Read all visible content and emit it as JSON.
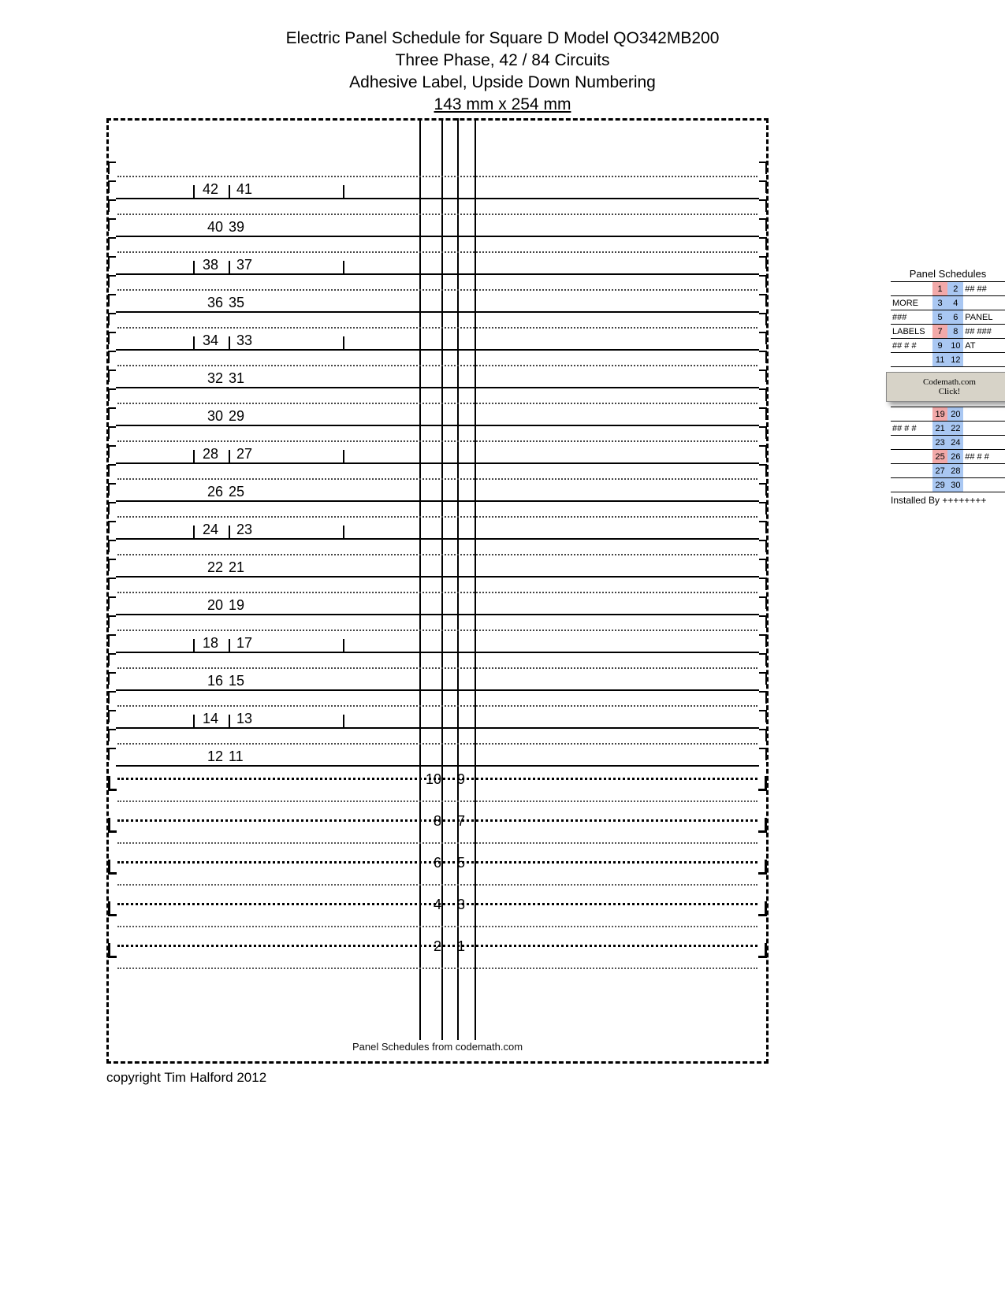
{
  "header": {
    "line1": "Electric Panel Schedule for Square D Model QO342MB200",
    "line2": "Three Phase, 42 / 84 Circuits",
    "line3": "Adhesive Label, Upside Down Numbering",
    "dimensions": "143 mm x 254 mm"
  },
  "rows_upper": [
    {
      "style": "dotted",
      "a": "",
      "b": ""
    },
    {
      "style": "solid",
      "a": "42",
      "b": "41",
      "ticks": true
    },
    {
      "style": "dotted",
      "a": "",
      "b": ""
    },
    {
      "style": "solid",
      "a": "40",
      "b": "39"
    },
    {
      "style": "dotted",
      "a": "",
      "b": ""
    },
    {
      "style": "solid",
      "a": "38",
      "b": "37",
      "ticks": true
    },
    {
      "style": "dotted",
      "a": "",
      "b": ""
    },
    {
      "style": "solid",
      "a": "36",
      "b": "35"
    },
    {
      "style": "dotted",
      "a": "",
      "b": ""
    },
    {
      "style": "solid",
      "a": "34",
      "b": "33",
      "ticks": true
    },
    {
      "style": "dotted",
      "a": "",
      "b": ""
    },
    {
      "style": "solid",
      "a": "32",
      "b": "31"
    },
    {
      "style": "dotted",
      "a": "",
      "b": ""
    },
    {
      "style": "solid",
      "a": "30",
      "b": "29"
    },
    {
      "style": "dotted",
      "a": "",
      "b": ""
    },
    {
      "style": "solid",
      "a": "28",
      "b": "27",
      "ticks": true
    },
    {
      "style": "dotted",
      "a": "",
      "b": ""
    },
    {
      "style": "solid",
      "a": "26",
      "b": "25"
    },
    {
      "style": "dotted",
      "a": "",
      "b": ""
    },
    {
      "style": "solid",
      "a": "24",
      "b": "23",
      "ticks": true
    },
    {
      "style": "dotted",
      "a": "",
      "b": ""
    },
    {
      "style": "solid",
      "a": "22",
      "b": "21"
    },
    {
      "style": "dotted",
      "a": "",
      "b": ""
    },
    {
      "style": "solid",
      "a": "20",
      "b": "19"
    },
    {
      "style": "dotted",
      "a": "",
      "b": ""
    },
    {
      "style": "solid",
      "a": "18",
      "b": "17",
      "ticks": true
    },
    {
      "style": "dotted",
      "a": "",
      "b": ""
    },
    {
      "style": "solid",
      "a": "16",
      "b": "15"
    },
    {
      "style": "dotted",
      "a": "",
      "b": ""
    },
    {
      "style": "solid",
      "a": "14",
      "b": "13",
      "ticks": true
    },
    {
      "style": "dotted",
      "a": "",
      "b": ""
    },
    {
      "style": "solid",
      "a": "12",
      "b": "11"
    }
  ],
  "rows_center": [
    {
      "a": "10",
      "b": "9"
    },
    {
      "a": "8",
      "b": "7"
    },
    {
      "a": "6",
      "b": "5"
    },
    {
      "a": "4",
      "b": "3"
    },
    {
      "a": "2",
      "b": "1"
    }
  ],
  "footer_inside": "Panel Schedules from codemath.com",
  "copyright": "copyright Tim Halford 2012",
  "mini": {
    "title": "Panel Schedules",
    "rows": [
      {
        "l": "",
        "n1": "1",
        "n2": "2",
        "c1": "red",
        "c2": "blue",
        "r": "## ##"
      },
      {
        "l": "MORE",
        "n1": "3",
        "n2": "4",
        "c1": "blue",
        "c2": "blue",
        "r": ""
      },
      {
        "l": "###",
        "n1": "5",
        "n2": "6",
        "c1": "blue",
        "c2": "blue",
        "r": "PANEL"
      },
      {
        "l": "LABELS",
        "n1": "7",
        "n2": "8",
        "c1": "red",
        "c2": "blue",
        "r": "## ###"
      },
      {
        "l": "## # #",
        "n1": "9",
        "n2": "10",
        "c1": "blue",
        "c2": "blue",
        "r": "AT"
      },
      {
        "l": "",
        "n1": "11",
        "n2": "12",
        "c1": "blue",
        "c2": "blue",
        "r": ""
      }
    ],
    "promo_line1": "Codemath.com",
    "promo_line2": "Click!",
    "rows2": [
      {
        "l": "",
        "n1": "19",
        "n2": "20",
        "c1": "red",
        "c2": "blue",
        "r": ""
      },
      {
        "l": "## # #",
        "n1": "21",
        "n2": "22",
        "c1": "blue",
        "c2": "blue",
        "r": ""
      },
      {
        "l": "",
        "n1": "23",
        "n2": "24",
        "c1": "blue",
        "c2": "blue",
        "r": ""
      },
      {
        "l": "",
        "n1": "25",
        "n2": "26",
        "c1": "red",
        "c2": "blue",
        "r": "## # #"
      },
      {
        "l": "",
        "n1": "27",
        "n2": "28",
        "c1": "blue",
        "c2": "blue",
        "r": ""
      },
      {
        "l": "",
        "n1": "29",
        "n2": "30",
        "c1": "blue",
        "c2": "blue",
        "r": ""
      }
    ],
    "installed": "Installed By ++++++++"
  }
}
